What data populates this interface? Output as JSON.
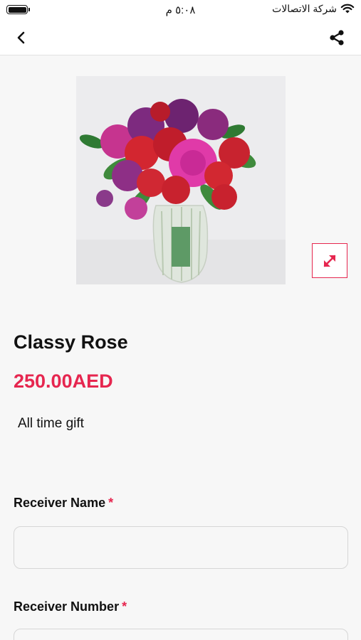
{
  "status_bar": {
    "carrier": "شركة الاتصالات",
    "time": "٥:٠٨ م",
    "battery_level": 1.0
  },
  "nav": {
    "back_icon": "chevron-left-icon",
    "share_icon": "share-icon"
  },
  "product": {
    "name": "Classy Rose",
    "price": "250.00AED",
    "description": "All time gift",
    "zoom_icon": "expand-arrows-icon"
  },
  "form": {
    "receiver_name": {
      "label": "Receiver Name",
      "required_mark": "*",
      "value": "",
      "placeholder": ""
    },
    "receiver_number": {
      "label": "Receiver Number",
      "required_mark": "*",
      "value": "",
      "placeholder": ""
    }
  },
  "colors": {
    "accent": "#e6264f",
    "background": "#f7f7f7"
  }
}
